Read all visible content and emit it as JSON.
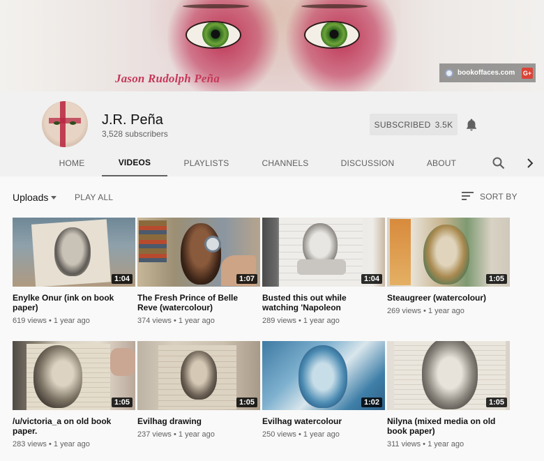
{
  "banner": {
    "signature": "Jason Rudolph Peña",
    "link_text": "bookoffaces.com",
    "gplus_label": "G+",
    "link_icon": "globe-icon"
  },
  "channel": {
    "name": "J.R. Peña",
    "subscribers": "3,528 subscribers",
    "subscribe_label": "SUBSCRIBED",
    "subscribe_count": "3.5K"
  },
  "tabs": [
    {
      "label": "HOME",
      "active": false
    },
    {
      "label": "VIDEOS",
      "active": true
    },
    {
      "label": "PLAYLISTS",
      "active": false
    },
    {
      "label": "CHANNELS",
      "active": false
    },
    {
      "label": "DISCUSSION",
      "active": false
    },
    {
      "label": "ABOUT",
      "active": false
    }
  ],
  "uploads": {
    "label": "Uploads",
    "play_all": "PLAY ALL",
    "sort_by": "SORT BY"
  },
  "videos": [
    {
      "title": "Enylke Onur (ink on book paper)",
      "views": "619 views",
      "age": "1 year ago",
      "duration": "1:04"
    },
    {
      "title": "The Fresh Prince of Belle Reve (watercolour)",
      "views": "374 views",
      "age": "1 year ago",
      "duration": "1:07"
    },
    {
      "title": "Busted this out while watching 'Napoleon",
      "views": "289 views",
      "age": "1 year ago",
      "duration": "1:04"
    },
    {
      "title": "Steaugreer (watercolour)",
      "views": "269 views",
      "age": "1 year ago",
      "duration": "1:05"
    },
    {
      "title": "/u/victoria_a on old book paper.",
      "views": "283 views",
      "age": "1 year ago",
      "duration": "1:05"
    },
    {
      "title": "Evilhag drawing",
      "views": "237 views",
      "age": "1 year ago",
      "duration": "1:05"
    },
    {
      "title": "Evilhag watercolour",
      "views": "250 views",
      "age": "1 year ago",
      "duration": "1:02"
    },
    {
      "title": "Nilyna (mixed media on old book paper)",
      "views": "311 views",
      "age": "1 year ago",
      "duration": "1:05"
    }
  ],
  "colors": {
    "background": "#f9f9f9",
    "header_bg": "#f1f1f1",
    "subscribe_bg": "#e5e5e5",
    "signature": "#c5385a",
    "duration_badge": "#000000"
  }
}
